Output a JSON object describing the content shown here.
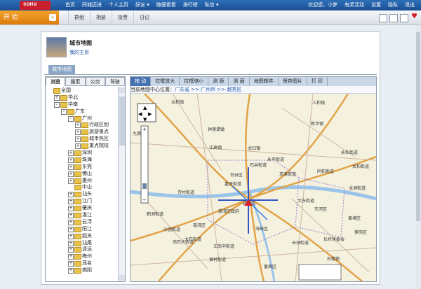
{
  "topbar": {
    "logo": "SOHU",
    "nav": [
      "首页",
      "同城迈进",
      "个人主页",
      "好友 ▾",
      "随便看看",
      "排行榜",
      "私信 ▾"
    ],
    "right": [
      "欢迎您，小梦",
      "有奖活动",
      "设置",
      "隐私",
      "退出"
    ]
  },
  "secondbar": {
    "start": "开 始",
    "nav": [
      "群组",
      "相册",
      "投票",
      "日记"
    ]
  },
  "page": {
    "title": "城市地图",
    "mypage": "我的主页",
    "tab": "城市地图"
  },
  "left_tabs": [
    "浏览",
    "搜索",
    "公交",
    "驾驶"
  ],
  "tree": [
    {
      "indent": 0,
      "box": "",
      "text": "全国"
    },
    {
      "indent": 1,
      "box": "+",
      "text": "华北"
    },
    {
      "indent": 1,
      "box": "-",
      "text": "华南"
    },
    {
      "indent": 2,
      "box": "-",
      "text": "广东"
    },
    {
      "indent": 3,
      "box": "-",
      "text": "广州"
    },
    {
      "indent": 4,
      "box": "+",
      "text": "行政区划"
    },
    {
      "indent": 4,
      "box": "+",
      "text": "旅游景点"
    },
    {
      "indent": 4,
      "box": "+",
      "text": "城市热区"
    },
    {
      "indent": 4,
      "box": "+",
      "text": "重点院校"
    },
    {
      "indent": 3,
      "box": "+",
      "text": "深圳"
    },
    {
      "indent": 3,
      "box": "+",
      "text": "珠海"
    },
    {
      "indent": 3,
      "box": "+",
      "text": "东莞"
    },
    {
      "indent": 3,
      "box": "+",
      "text": "佛山"
    },
    {
      "indent": 3,
      "box": "+",
      "text": "惠州"
    },
    {
      "indent": 3,
      "box": "",
      "text": "中山"
    },
    {
      "indent": 3,
      "box": "+",
      "text": "汕头"
    },
    {
      "indent": 3,
      "box": "+",
      "text": "江门"
    },
    {
      "indent": 3,
      "box": "+",
      "text": "肇庆"
    },
    {
      "indent": 3,
      "box": "+",
      "text": "湛江"
    },
    {
      "indent": 3,
      "box": "+",
      "text": "云浮"
    },
    {
      "indent": 3,
      "box": "+",
      "text": "阳江"
    },
    {
      "indent": 3,
      "box": "+",
      "text": "韶关"
    },
    {
      "indent": 3,
      "box": "+",
      "text": "汕尾"
    },
    {
      "indent": 3,
      "box": "+",
      "text": "清远"
    },
    {
      "indent": 3,
      "box": "+",
      "text": "梅州"
    },
    {
      "indent": 3,
      "box": "+",
      "text": "茂名"
    },
    {
      "indent": 3,
      "box": "+",
      "text": "揭阳"
    }
  ],
  "map_tools": [
    "拖 动",
    "拉框放大",
    "拉框缩小",
    "测 距",
    "测 面",
    "地图邮件",
    "保存图片",
    "打 印"
  ],
  "location": {
    "prefix": "当前地图中心位置：",
    "path": "广东省 >> 广州市 >> 越秀区"
  },
  "map_labels": [
    "太和镇",
    "九佛镇",
    "钟落潭镇",
    "人和镇",
    "新华镇",
    "江高镇",
    "龙归镇",
    "永平街道",
    "石井街道",
    "太和街道",
    "白云区",
    "京溪街道",
    "同和街道",
    "嘉禾街道",
    "芳村街道",
    "越秀区",
    "天河区",
    "黄埔区",
    "荔湾区",
    "海珠区",
    "番禺区",
    "石楼镇",
    "大石街道",
    "长洲街道",
    "南石头街道",
    "江南中街道",
    "鹤洞街道",
    "荔湾区政府",
    "沙园街道",
    "大东街道",
    "黄村街道",
    "萝岗区",
    "长岭居委会",
    "龙洞街道",
    "永和街道"
  ]
}
